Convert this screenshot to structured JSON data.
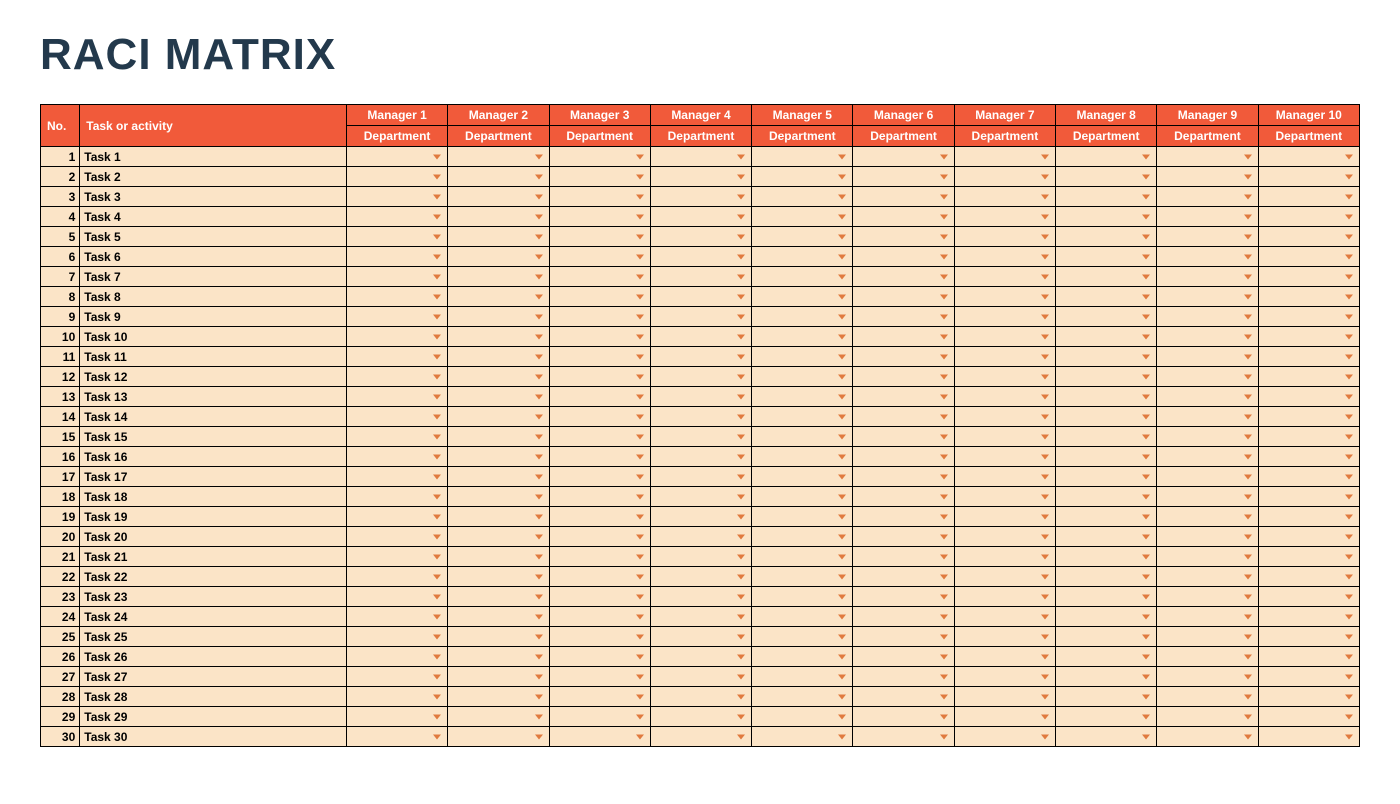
{
  "title": "RACI MATRIX",
  "headers": {
    "no": "No.",
    "task": "Task or activity",
    "managers": [
      "Manager 1",
      "Manager 2",
      "Manager 3",
      "Manager 4",
      "Manager 5",
      "Manager 6",
      "Manager 7",
      "Manager 8",
      "Manager 9",
      "Manager 10"
    ],
    "dept": "Department"
  },
  "rows": [
    {
      "no": 1,
      "task": "Task 1",
      "cells": [
        "",
        "",
        "",
        "",
        "",
        "",
        "",
        "",
        "",
        ""
      ]
    },
    {
      "no": 2,
      "task": "Task 2",
      "cells": [
        "",
        "",
        "",
        "",
        "",
        "",
        "",
        "",
        "",
        ""
      ]
    },
    {
      "no": 3,
      "task": "Task 3",
      "cells": [
        "",
        "",
        "",
        "",
        "",
        "",
        "",
        "",
        "",
        ""
      ]
    },
    {
      "no": 4,
      "task": "Task 4",
      "cells": [
        "",
        "",
        "",
        "",
        "",
        "",
        "",
        "",
        "",
        ""
      ]
    },
    {
      "no": 5,
      "task": "Task 5",
      "cells": [
        "",
        "",
        "",
        "",
        "",
        "",
        "",
        "",
        "",
        ""
      ]
    },
    {
      "no": 6,
      "task": "Task 6",
      "cells": [
        "",
        "",
        "",
        "",
        "",
        "",
        "",
        "",
        "",
        ""
      ]
    },
    {
      "no": 7,
      "task": "Task 7",
      "cells": [
        "",
        "",
        "",
        "",
        "",
        "",
        "",
        "",
        "",
        ""
      ]
    },
    {
      "no": 8,
      "task": "Task 8",
      "cells": [
        "",
        "",
        "",
        "",
        "",
        "",
        "",
        "",
        "",
        ""
      ]
    },
    {
      "no": 9,
      "task": "Task 9",
      "cells": [
        "",
        "",
        "",
        "",
        "",
        "",
        "",
        "",
        "",
        ""
      ]
    },
    {
      "no": 10,
      "task": "Task 10",
      "cells": [
        "",
        "",
        "",
        "",
        "",
        "",
        "",
        "",
        "",
        ""
      ]
    },
    {
      "no": 11,
      "task": "Task 11",
      "cells": [
        "",
        "",
        "",
        "",
        "",
        "",
        "",
        "",
        "",
        ""
      ]
    },
    {
      "no": 12,
      "task": "Task 12",
      "cells": [
        "",
        "",
        "",
        "",
        "",
        "",
        "",
        "",
        "",
        ""
      ]
    },
    {
      "no": 13,
      "task": "Task 13",
      "cells": [
        "",
        "",
        "",
        "",
        "",
        "",
        "",
        "",
        "",
        ""
      ]
    },
    {
      "no": 14,
      "task": "Task 14",
      "cells": [
        "",
        "",
        "",
        "",
        "",
        "",
        "",
        "",
        "",
        ""
      ]
    },
    {
      "no": 15,
      "task": "Task 15",
      "cells": [
        "",
        "",
        "",
        "",
        "",
        "",
        "",
        "",
        "",
        ""
      ]
    },
    {
      "no": 16,
      "task": "Task 16",
      "cells": [
        "",
        "",
        "",
        "",
        "",
        "",
        "",
        "",
        "",
        ""
      ]
    },
    {
      "no": 17,
      "task": "Task 17",
      "cells": [
        "",
        "",
        "",
        "",
        "",
        "",
        "",
        "",
        "",
        ""
      ]
    },
    {
      "no": 18,
      "task": "Task 18",
      "cells": [
        "",
        "",
        "",
        "",
        "",
        "",
        "",
        "",
        "",
        ""
      ]
    },
    {
      "no": 19,
      "task": "Task 19",
      "cells": [
        "",
        "",
        "",
        "",
        "",
        "",
        "",
        "",
        "",
        ""
      ]
    },
    {
      "no": 20,
      "task": "Task 20",
      "cells": [
        "",
        "",
        "",
        "",
        "",
        "",
        "",
        "",
        "",
        ""
      ]
    },
    {
      "no": 21,
      "task": "Task 21",
      "cells": [
        "",
        "",
        "",
        "",
        "",
        "",
        "",
        "",
        "",
        ""
      ]
    },
    {
      "no": 22,
      "task": "Task 22",
      "cells": [
        "",
        "",
        "",
        "",
        "",
        "",
        "",
        "",
        "",
        ""
      ]
    },
    {
      "no": 23,
      "task": "Task 23",
      "cells": [
        "",
        "",
        "",
        "",
        "",
        "",
        "",
        "",
        "",
        ""
      ]
    },
    {
      "no": 24,
      "task": "Task 24",
      "cells": [
        "",
        "",
        "",
        "",
        "",
        "",
        "",
        "",
        "",
        ""
      ]
    },
    {
      "no": 25,
      "task": "Task 25",
      "cells": [
        "",
        "",
        "",
        "",
        "",
        "",
        "",
        "",
        "",
        ""
      ]
    },
    {
      "no": 26,
      "task": "Task 26",
      "cells": [
        "",
        "",
        "",
        "",
        "",
        "",
        "",
        "",
        "",
        ""
      ]
    },
    {
      "no": 27,
      "task": "Task 27",
      "cells": [
        "",
        "",
        "",
        "",
        "",
        "",
        "",
        "",
        "",
        ""
      ]
    },
    {
      "no": 28,
      "task": "Task 28",
      "cells": [
        "",
        "",
        "",
        "",
        "",
        "",
        "",
        "",
        "",
        ""
      ]
    },
    {
      "no": 29,
      "task": "Task 29",
      "cells": [
        "",
        "",
        "",
        "",
        "",
        "",
        "",
        "",
        "",
        ""
      ]
    },
    {
      "no": 30,
      "task": "Task 30",
      "cells": [
        "",
        "",
        "",
        "",
        "",
        "",
        "",
        "",
        "",
        ""
      ]
    }
  ]
}
